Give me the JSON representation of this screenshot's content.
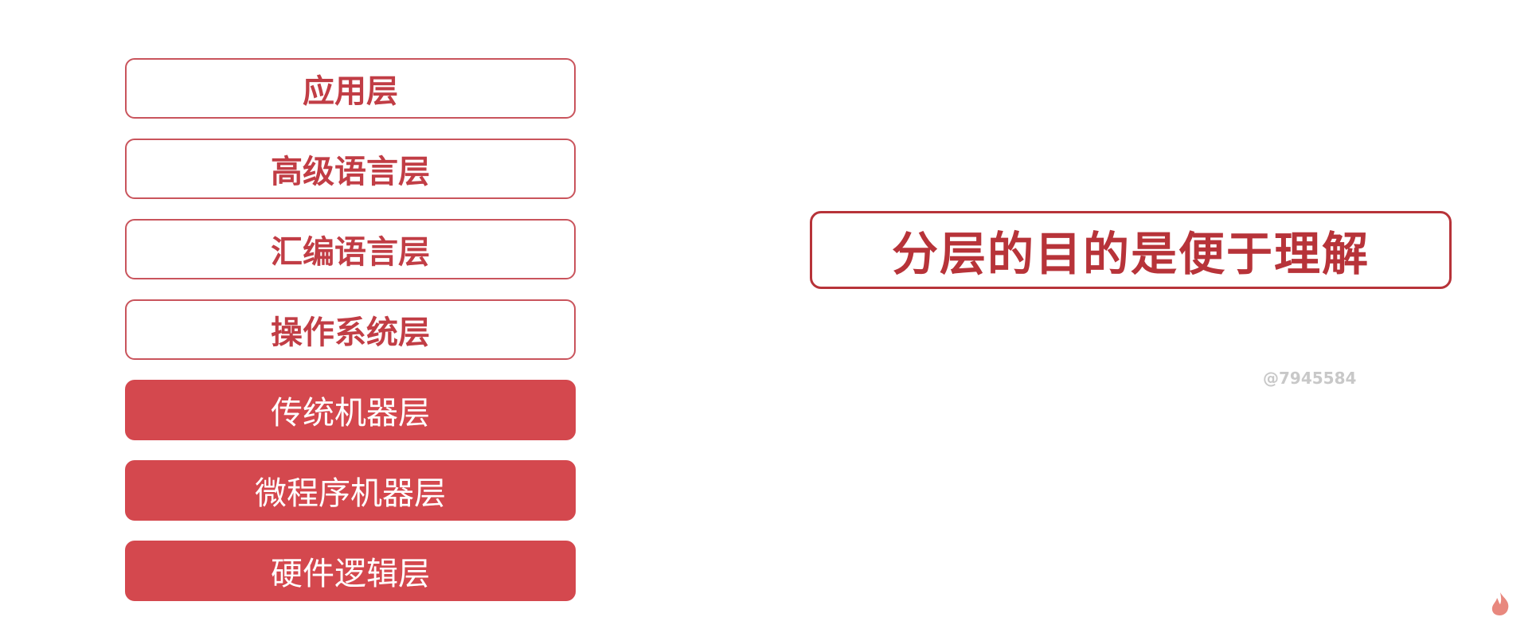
{
  "layers": [
    {
      "label": "应用层",
      "style": "outline"
    },
    {
      "label": "高级语言层",
      "style": "outline"
    },
    {
      "label": "汇编语言层",
      "style": "outline"
    },
    {
      "label": "操作系统层",
      "style": "outline"
    },
    {
      "label": "传统机器层",
      "style": "filled"
    },
    {
      "label": "微程序机器层",
      "style": "filled"
    },
    {
      "label": "硬件逻辑层",
      "style": "filled"
    }
  ],
  "purpose": {
    "text": "分层的目的是便于理解"
  },
  "watermark": {
    "text": "@7945584"
  },
  "colors": {
    "accent": "#d4484e",
    "outline_text": "#c13d45",
    "purpose_border": "#b73339"
  },
  "icons": {
    "corner": "flame-icon"
  }
}
